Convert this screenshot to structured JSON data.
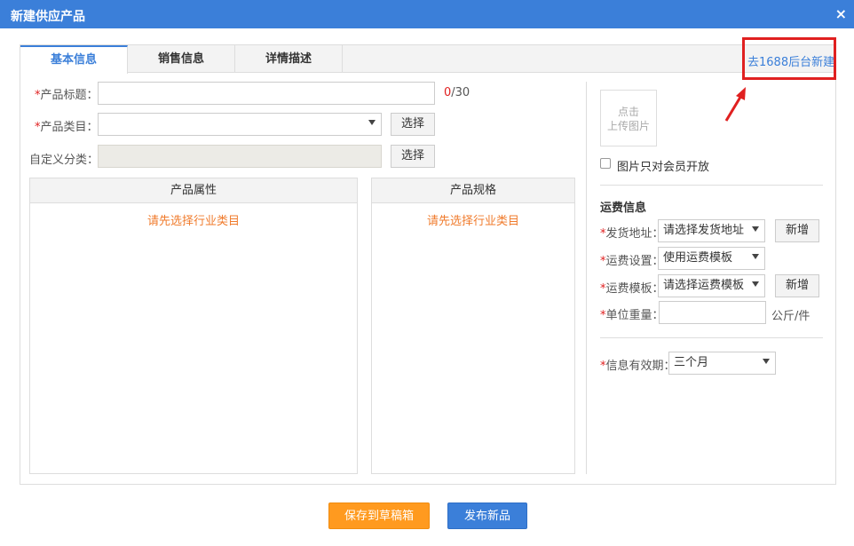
{
  "dialog": {
    "title": "新建供应产品",
    "close_glyph": "×"
  },
  "tabs": [
    {
      "label": "基本信息",
      "active": true
    },
    {
      "label": "销售信息",
      "active": false
    },
    {
      "label": "详情描述",
      "active": false
    }
  ],
  "goto_link": "去1688后台新建",
  "form": {
    "title_label": "产品标题：",
    "title_value": "",
    "title_count": "0",
    "title_max": "/30",
    "category_label": "产品类目：",
    "category_value": "",
    "category_button": "选择",
    "custom_label": "自定义分类：",
    "custom_value": "",
    "custom_button": "选择",
    "required_mark": "*"
  },
  "attributes_box": {
    "header": "产品属性",
    "hint": "请先选择行业类目"
  },
  "specs_box": {
    "header": "产品规格",
    "hint": "请先选择行业类目"
  },
  "upload": {
    "line1": "点击",
    "line2": "上传图片"
  },
  "members_only": {
    "label": "图片只对会员开放",
    "checked": false
  },
  "shipping": {
    "title": "运费信息",
    "address_label": "发货地址：",
    "address_value": "请选择发货地址",
    "address_add": "新增",
    "setting_label": "运费设置：",
    "setting_value": "使用运费模板",
    "template_label": "运费模板：",
    "template_value": "请选择运费模板",
    "template_add": "新增",
    "weight_label": "单位重量：",
    "weight_value": "",
    "weight_unit": "公斤/件"
  },
  "validity": {
    "label": "信息有效期：",
    "value": "三个月"
  },
  "footer": {
    "draft_button": "保存到草稿箱",
    "publish_button": "发布新品"
  },
  "colors": {
    "accent": "#3b7fd9",
    "orange": "#ff9a1f",
    "required": "#e02020",
    "hint": "#f07b2c",
    "annotation": "#e02020"
  }
}
